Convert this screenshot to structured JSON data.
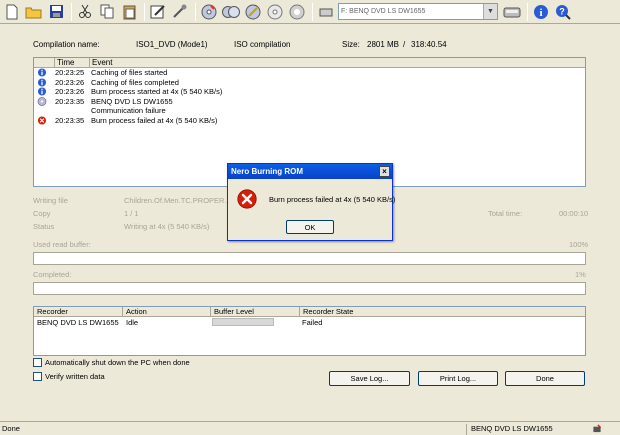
{
  "toolbar": {
    "icons": [
      "new-icon",
      "open-icon",
      "save-icon",
      "cut-icon",
      "copy-icon",
      "paste-icon",
      "edit-icon",
      "tools-icon",
      "burn-icon",
      "copy-disc-icon",
      "erase-icon",
      "eject-icon",
      "info-icon",
      "drive-icon",
      "drive-info-icon",
      "help-icon",
      "whats-this-icon"
    ],
    "drive_label": "F: BENQ     DVD LS DW1655"
  },
  "compilation": {
    "name_label": "Compilation name:",
    "name_value": "ISO1_DVD (Mode1)",
    "type_value": "ISO compilation",
    "size_label": "Size:",
    "size_value": "2801 MB",
    "size_sep": "/",
    "duration_value": "318:40.54"
  },
  "log": {
    "col_time": "Time",
    "col_event": "Event",
    "rows": [
      {
        "icon": "info-icon",
        "time": "20:23:25",
        "event": "Caching of files started"
      },
      {
        "icon": "info-icon",
        "time": "20:23:26",
        "event": "Caching of files completed"
      },
      {
        "icon": "info-icon",
        "time": "20:23:26",
        "event": "Burn process started at 4x (5 540 KB/s)"
      },
      {
        "icon": "drive-icon",
        "time": "20:23:35",
        "event": "BENQ     DVD LS DW1655"
      },
      {
        "icon": "",
        "time": "",
        "event": "Communication failure"
      },
      {
        "icon": "error-icon",
        "time": "20:23:35",
        "event": "Burn process failed at 4x (5 540 KB/s)"
      }
    ]
  },
  "status": {
    "writing_file_label": "Writing file",
    "writing_file_value": "Children.Of.Men.TC.PROPER.XV",
    "copy_label": "Copy",
    "copy_value": "1 / 1",
    "status_label": "Status",
    "status_value": "Writing at 4x (5 540 KB/s)",
    "total_time_label": "Total time:",
    "total_time_value": "00:00:10",
    "read_buffer_label": "Used read buffer:",
    "read_buffer_pct": "100%",
    "completed_label": "Completed:",
    "completed_pct": "1%"
  },
  "recorder": {
    "col_recorder": "Recorder",
    "col_action": "Action",
    "col_buffer": "Buffer Level",
    "col_state": "Recorder State",
    "row": {
      "recorder": "BENQ DVD LS DW1655",
      "action": "Idle",
      "state": "Failed"
    }
  },
  "options": {
    "auto_shutdown": "Automatically shut down the PC when done",
    "verify": "Verify written data"
  },
  "buttons": {
    "save_log": "Save Log...",
    "print_log": "Print Log...",
    "done": "Done"
  },
  "statusbar": {
    "left": "Done",
    "drive": "BENQ     DVD LS DW1655"
  },
  "dialog": {
    "title": "Nero Burning ROM",
    "close": "×",
    "message": "Burn process failed at 4x (5 540 KB/s)",
    "ok": "OK"
  },
  "colors": {
    "info": "#2a5bd7",
    "error": "#d81e06",
    "title_bar": "#0842c6"
  }
}
